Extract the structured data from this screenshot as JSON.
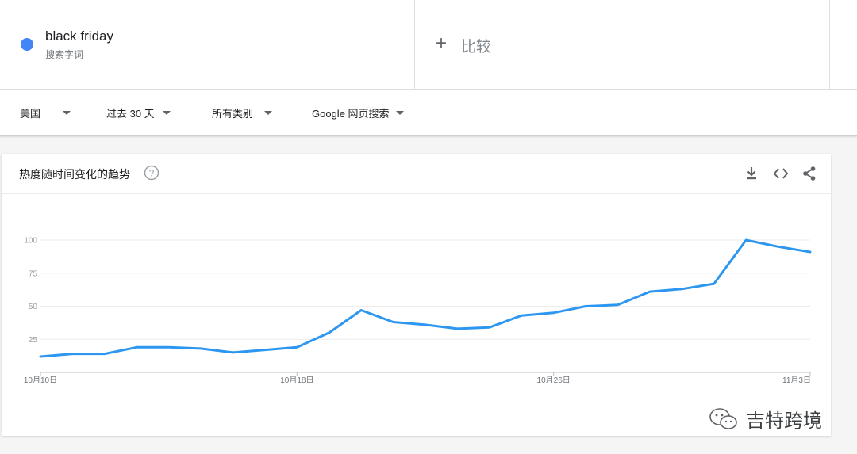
{
  "term": {
    "name": "black friday",
    "sublabel": "搜索字词",
    "color": "#4285f4"
  },
  "compare": {
    "label": "比较"
  },
  "filters": [
    {
      "label": "美国"
    },
    {
      "label": "过去 30 天"
    },
    {
      "label": "所有类别"
    },
    {
      "label": "Google 网页搜索"
    }
  ],
  "card": {
    "title": "热度随时间变化的趋势"
  },
  "watermark": {
    "text": "吉特跨境"
  },
  "chart_data": {
    "type": "line",
    "title": "热度随时间变化的趋势",
    "xlabel": "",
    "ylabel": "",
    "ylim": [
      0,
      100
    ],
    "y_ticks": [
      "100",
      "75",
      "50",
      "25"
    ],
    "x_tick_labels": [
      "10月10日",
      "10月18日",
      "10月26日",
      "11月3日"
    ],
    "grid": true,
    "line_color": "#2d96f0",
    "series": [
      {
        "x": [
          "10月10日",
          "10月11日",
          "10月12日",
          "10月13日",
          "10月14日",
          "10月15日",
          "10月16日",
          "10月17日",
          "10月18日",
          "10月19日",
          "10月20日",
          "10月21日",
          "10月22日",
          "10月23日",
          "10月24日",
          "10月25日",
          "10月26日",
          "10月27日",
          "10月28日",
          "10月29日",
          "10月30日",
          "10月31日",
          "11月1日",
          "11月2日",
          "11月3日"
        ],
        "values": [
          12,
          14,
          14,
          19,
          19,
          18,
          15,
          17,
          19,
          30,
          47,
          38,
          36,
          33,
          34,
          43,
          45,
          50,
          51,
          61,
          63,
          67,
          100,
          95,
          91
        ]
      }
    ]
  }
}
